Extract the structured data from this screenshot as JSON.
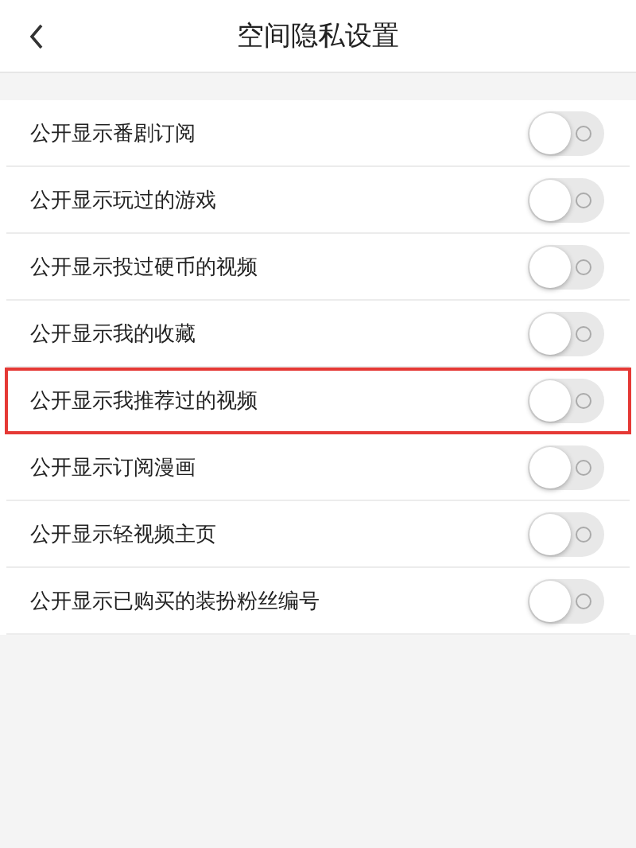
{
  "header": {
    "title": "空间隐私设置"
  },
  "settings": [
    {
      "label": "公开显示番剧订阅",
      "on": false,
      "highlighted": false
    },
    {
      "label": "公开显示玩过的游戏",
      "on": false,
      "highlighted": false
    },
    {
      "label": "公开显示投过硬币的视频",
      "on": false,
      "highlighted": false
    },
    {
      "label": "公开显示我的收藏",
      "on": false,
      "highlighted": false
    },
    {
      "label": "公开显示我推荐过的视频",
      "on": false,
      "highlighted": true
    },
    {
      "label": "公开显示订阅漫画",
      "on": false,
      "highlighted": false
    },
    {
      "label": "公开显示轻视频主页",
      "on": false,
      "highlighted": false
    },
    {
      "label": "公开显示已购买的装扮粉丝编号",
      "on": false,
      "highlighted": false
    }
  ]
}
